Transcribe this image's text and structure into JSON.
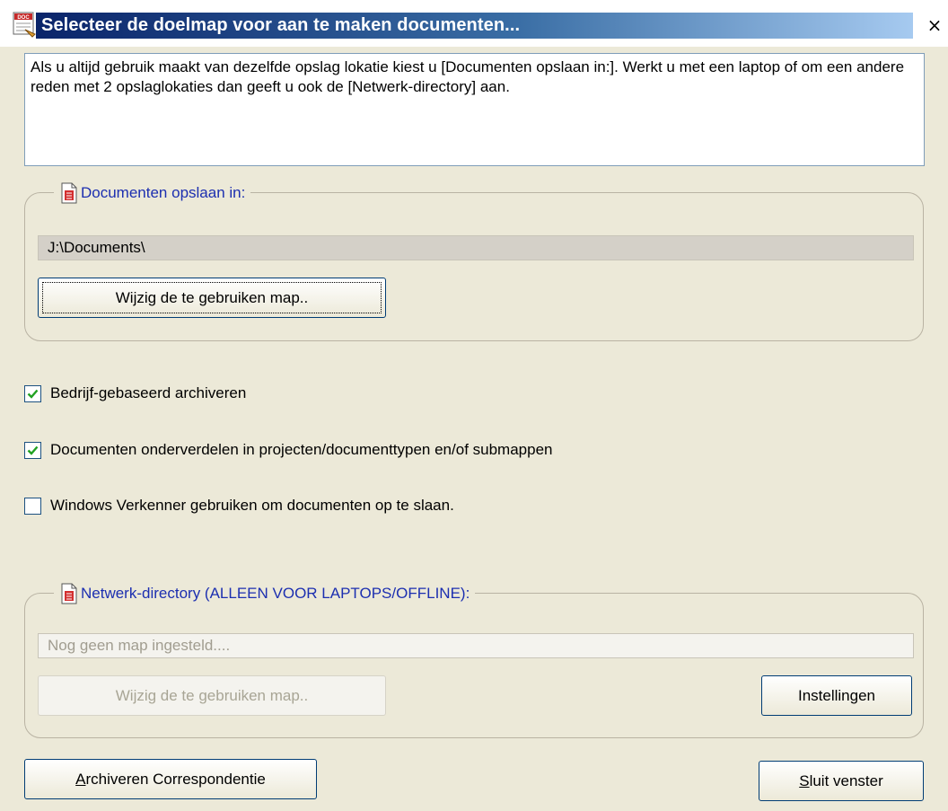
{
  "window": {
    "title": "Selecteer de doelmap voor aan te maken documenten...",
    "close_glyph": "×",
    "app_icon": "doc-app-icon"
  },
  "info_text": "Als u altijd gebruik maakt van dezelfde opslag lokatie kiest u [Documenten opslaan in:]. Werkt u met een laptop of om een andere reden met 2 opslaglokaties dan geeft u ook  de [Netwerk-directory] aan.",
  "documents_group": {
    "legend": "Documenten opslaan in:",
    "legend_icon": "document-icon",
    "path_value": "J:\\Documents\\",
    "change_button": "Wijzig de te gebruiken map.."
  },
  "checkboxes": [
    {
      "label": "Bedrijf-gebaseerd archiveren",
      "checked": true
    },
    {
      "label": "Documenten onderverdelen in projecten/documenttypen en/of submappen",
      "checked": true
    },
    {
      "label": "Windows Verkenner gebruiken om documenten op te slaan.",
      "checked": false
    }
  ],
  "network_group": {
    "legend": "Netwerk-directory (ALLEEN VOOR LAPTOPS/OFFLINE):",
    "legend_icon": "document-icon",
    "path_placeholder": "Nog geen map ingesteld....",
    "change_button": "Wijzig de te gebruiken map..",
    "settings_button": "Instellingen"
  },
  "footer": {
    "archive_button_accel": "A",
    "archive_button_rest": "rchiveren Correspondentie",
    "close_button_accel": "S",
    "close_button_rest": "luit venster"
  },
  "colors": {
    "title_gradient_start": "#0a246a",
    "title_gradient_end": "#a6caf0",
    "group_legend": "#1c2fb0",
    "dialog_bg": "#ece9d8",
    "check_green": "#21a121"
  }
}
